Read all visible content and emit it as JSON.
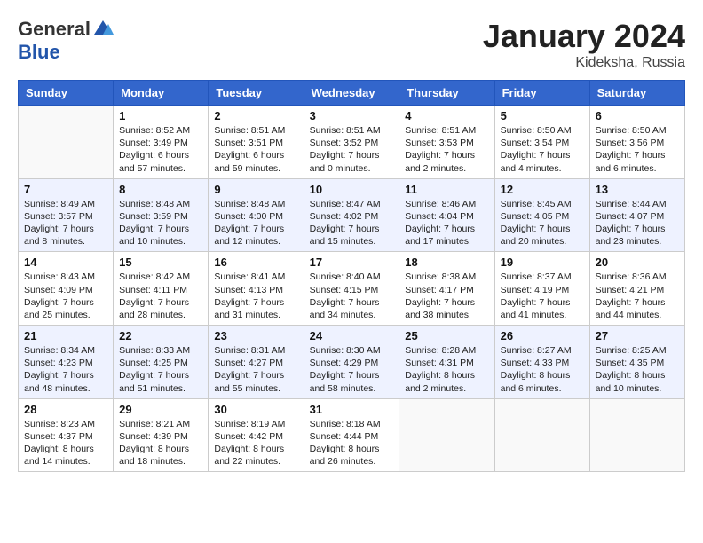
{
  "logo": {
    "general": "General",
    "blue": "Blue"
  },
  "title": {
    "month": "January 2024",
    "location": "Kideksha, Russia"
  },
  "weekdays": [
    "Sunday",
    "Monday",
    "Tuesday",
    "Wednesday",
    "Thursday",
    "Friday",
    "Saturday"
  ],
  "weeks": [
    [
      {
        "day": "",
        "info": ""
      },
      {
        "day": "1",
        "info": "Sunrise: 8:52 AM\nSunset: 3:49 PM\nDaylight: 6 hours\nand 57 minutes."
      },
      {
        "day": "2",
        "info": "Sunrise: 8:51 AM\nSunset: 3:51 PM\nDaylight: 6 hours\nand 59 minutes."
      },
      {
        "day": "3",
        "info": "Sunrise: 8:51 AM\nSunset: 3:52 PM\nDaylight: 7 hours\nand 0 minutes."
      },
      {
        "day": "4",
        "info": "Sunrise: 8:51 AM\nSunset: 3:53 PM\nDaylight: 7 hours\nand 2 minutes."
      },
      {
        "day": "5",
        "info": "Sunrise: 8:50 AM\nSunset: 3:54 PM\nDaylight: 7 hours\nand 4 minutes."
      },
      {
        "day": "6",
        "info": "Sunrise: 8:50 AM\nSunset: 3:56 PM\nDaylight: 7 hours\nand 6 minutes."
      }
    ],
    [
      {
        "day": "7",
        "info": "Sunrise: 8:49 AM\nSunset: 3:57 PM\nDaylight: 7 hours\nand 8 minutes."
      },
      {
        "day": "8",
        "info": "Sunrise: 8:48 AM\nSunset: 3:59 PM\nDaylight: 7 hours\nand 10 minutes."
      },
      {
        "day": "9",
        "info": "Sunrise: 8:48 AM\nSunset: 4:00 PM\nDaylight: 7 hours\nand 12 minutes."
      },
      {
        "day": "10",
        "info": "Sunrise: 8:47 AM\nSunset: 4:02 PM\nDaylight: 7 hours\nand 15 minutes."
      },
      {
        "day": "11",
        "info": "Sunrise: 8:46 AM\nSunset: 4:04 PM\nDaylight: 7 hours\nand 17 minutes."
      },
      {
        "day": "12",
        "info": "Sunrise: 8:45 AM\nSunset: 4:05 PM\nDaylight: 7 hours\nand 20 minutes."
      },
      {
        "day": "13",
        "info": "Sunrise: 8:44 AM\nSunset: 4:07 PM\nDaylight: 7 hours\nand 23 minutes."
      }
    ],
    [
      {
        "day": "14",
        "info": "Sunrise: 8:43 AM\nSunset: 4:09 PM\nDaylight: 7 hours\nand 25 minutes."
      },
      {
        "day": "15",
        "info": "Sunrise: 8:42 AM\nSunset: 4:11 PM\nDaylight: 7 hours\nand 28 minutes."
      },
      {
        "day": "16",
        "info": "Sunrise: 8:41 AM\nSunset: 4:13 PM\nDaylight: 7 hours\nand 31 minutes."
      },
      {
        "day": "17",
        "info": "Sunrise: 8:40 AM\nSunset: 4:15 PM\nDaylight: 7 hours\nand 34 minutes."
      },
      {
        "day": "18",
        "info": "Sunrise: 8:38 AM\nSunset: 4:17 PM\nDaylight: 7 hours\nand 38 minutes."
      },
      {
        "day": "19",
        "info": "Sunrise: 8:37 AM\nSunset: 4:19 PM\nDaylight: 7 hours\nand 41 minutes."
      },
      {
        "day": "20",
        "info": "Sunrise: 8:36 AM\nSunset: 4:21 PM\nDaylight: 7 hours\nand 44 minutes."
      }
    ],
    [
      {
        "day": "21",
        "info": "Sunrise: 8:34 AM\nSunset: 4:23 PM\nDaylight: 7 hours\nand 48 minutes."
      },
      {
        "day": "22",
        "info": "Sunrise: 8:33 AM\nSunset: 4:25 PM\nDaylight: 7 hours\nand 51 minutes."
      },
      {
        "day": "23",
        "info": "Sunrise: 8:31 AM\nSunset: 4:27 PM\nDaylight: 7 hours\nand 55 minutes."
      },
      {
        "day": "24",
        "info": "Sunrise: 8:30 AM\nSunset: 4:29 PM\nDaylight: 7 hours\nand 58 minutes."
      },
      {
        "day": "25",
        "info": "Sunrise: 8:28 AM\nSunset: 4:31 PM\nDaylight: 8 hours\nand 2 minutes."
      },
      {
        "day": "26",
        "info": "Sunrise: 8:27 AM\nSunset: 4:33 PM\nDaylight: 8 hours\nand 6 minutes."
      },
      {
        "day": "27",
        "info": "Sunrise: 8:25 AM\nSunset: 4:35 PM\nDaylight: 8 hours\nand 10 minutes."
      }
    ],
    [
      {
        "day": "28",
        "info": "Sunrise: 8:23 AM\nSunset: 4:37 PM\nDaylight: 8 hours\nand 14 minutes."
      },
      {
        "day": "29",
        "info": "Sunrise: 8:21 AM\nSunset: 4:39 PM\nDaylight: 8 hours\nand 18 minutes."
      },
      {
        "day": "30",
        "info": "Sunrise: 8:19 AM\nSunset: 4:42 PM\nDaylight: 8 hours\nand 22 minutes."
      },
      {
        "day": "31",
        "info": "Sunrise: 8:18 AM\nSunset: 4:44 PM\nDaylight: 8 hours\nand 26 minutes."
      },
      {
        "day": "",
        "info": ""
      },
      {
        "day": "",
        "info": ""
      },
      {
        "day": "",
        "info": ""
      }
    ]
  ]
}
